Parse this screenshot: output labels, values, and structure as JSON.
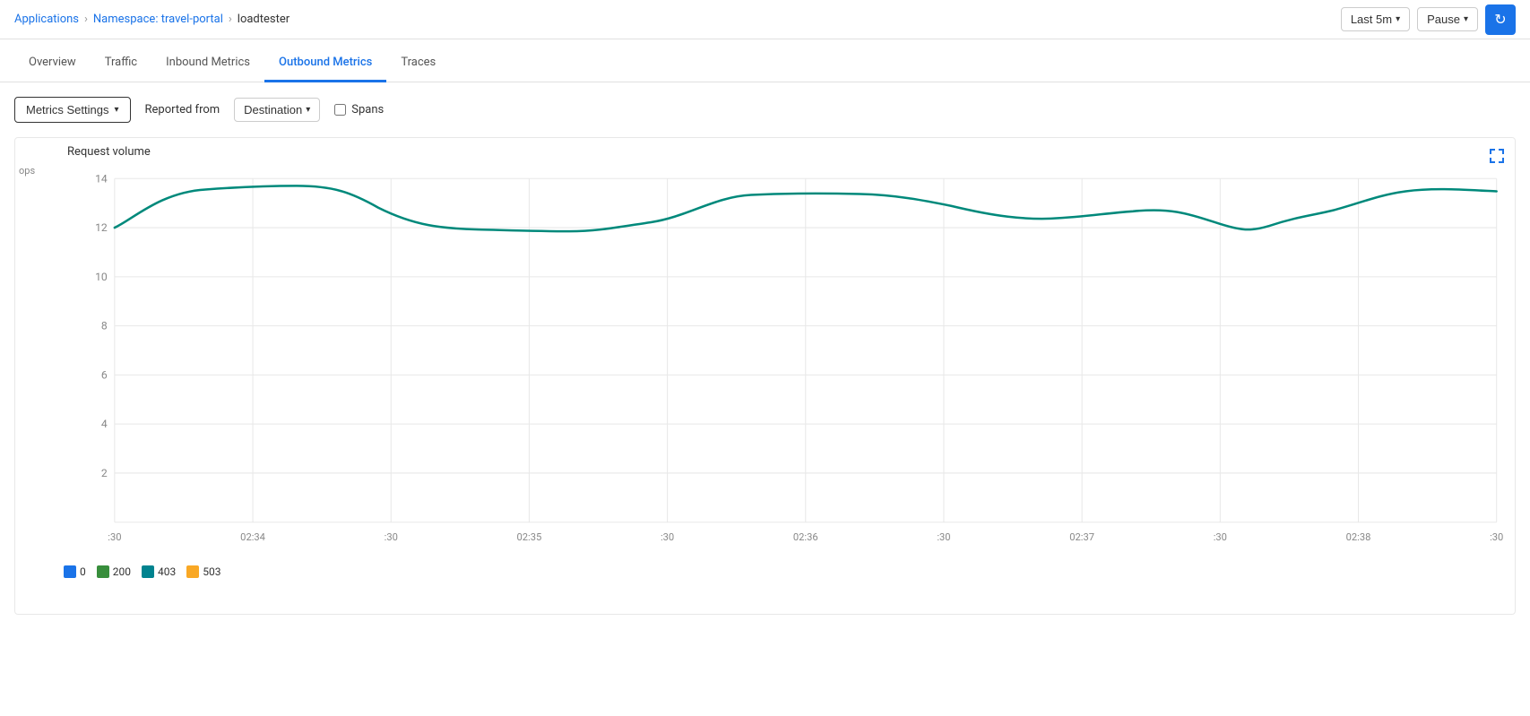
{
  "breadcrumb": {
    "applications": "Applications",
    "namespace": "Namespace: travel-portal",
    "current": "loadtester"
  },
  "header": {
    "time_range_label": "Last 5m",
    "pause_label": "Pause",
    "refresh_icon": "↻"
  },
  "tabs": [
    {
      "id": "overview",
      "label": "Overview",
      "active": false
    },
    {
      "id": "traffic",
      "label": "Traffic",
      "active": false
    },
    {
      "id": "inbound-metrics",
      "label": "Inbound Metrics",
      "active": false
    },
    {
      "id": "outbound-metrics",
      "label": "Outbound Metrics",
      "active": true
    },
    {
      "id": "traces",
      "label": "Traces",
      "active": false
    }
  ],
  "toolbar": {
    "metrics_settings_label": "Metrics Settings",
    "reported_from_label": "Reported from",
    "destination_label": "Destination",
    "spans_label": "Spans"
  },
  "chart": {
    "title": "Request volume",
    "y_label": "ops",
    "y_ticks": [
      "14",
      "12",
      "10",
      "8",
      "6",
      "4",
      "2",
      ""
    ],
    "x_ticks": [
      ":30",
      "02:34",
      ":30",
      "02:35",
      ":30",
      "02:36",
      ":30",
      "02:37",
      ":30",
      "02:38",
      ":30"
    ],
    "expand_icon": "⛶"
  },
  "legend": [
    {
      "label": "0",
      "color": "#1a73e8"
    },
    {
      "label": "200",
      "color": "#388e3c"
    },
    {
      "label": "403",
      "color": "#00838f"
    },
    {
      "label": "503",
      "color": "#f9a825"
    }
  ]
}
